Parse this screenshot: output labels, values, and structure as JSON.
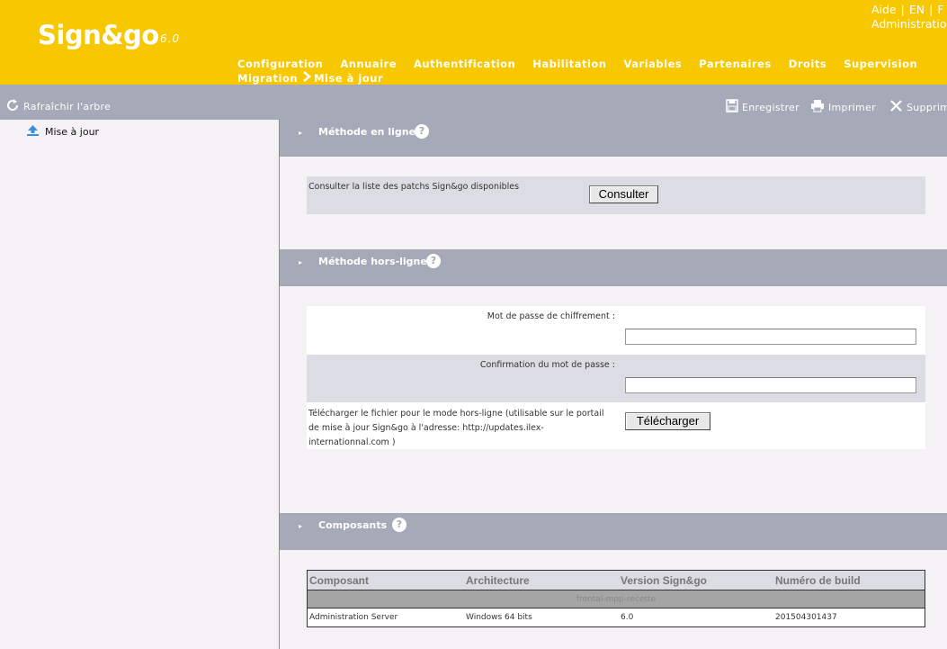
{
  "header": {
    "logo": "Sign&go",
    "version": "6.0",
    "top_links": [
      "Aide",
      "EN",
      "F"
    ],
    "admin_link": "Administration",
    "nav_row1": [
      "Configuration",
      "Annuaire",
      "Authentification",
      "Habilitation",
      "Variables",
      "Partenaires",
      "Droits",
      "Supervision"
    ],
    "nav_row2": [
      "Migration",
      "Mise à jour"
    ]
  },
  "toolbar": {
    "refresh_label": "Rafraîchir l'arbre",
    "save_label": "Enregistrer",
    "print_label": "Imprimer",
    "delete_label": "Supprimer"
  },
  "sidebar": {
    "items": [
      {
        "label": "Mise à jour",
        "icon": "upload-icon"
      }
    ]
  },
  "sections": {
    "online": {
      "title": "Méthode en ligne",
      "consult_text": "Consulter la liste des patchs Sign&go disponibles",
      "consult_button": "Consulter"
    },
    "offline": {
      "title": "Méthode hors-ligne",
      "password_label": "Mot de passe de chiffrement :",
      "password_value": "",
      "confirm_label": "Confirmation du mot de passe :",
      "confirm_value": "",
      "download_text_1": "Télécharger le fichier pour le mode hors-ligne (utilisable sur le portail",
      "download_text_2": "de mise à jour Sign&go à l'adresse: ",
      "download_url_1": "http://updates.ilex-",
      "download_url_2": "internationnal.com",
      "download_text_3": " )",
      "download_button": "Télécharger"
    },
    "components": {
      "title": "Composants",
      "columns": [
        "Composant",
        "Architecture",
        "Version Sign&go",
        "Numéro de build"
      ],
      "group": "frontal-mpp-recette",
      "rows": [
        [
          "Administration Server",
          "Windows 64 bits",
          "6.0",
          "201504301437"
        ]
      ]
    }
  },
  "colors": {
    "header_bg": "#f7c700",
    "bar_bg": "#a5a9b8",
    "panel_bg": "#f5f2f5"
  }
}
